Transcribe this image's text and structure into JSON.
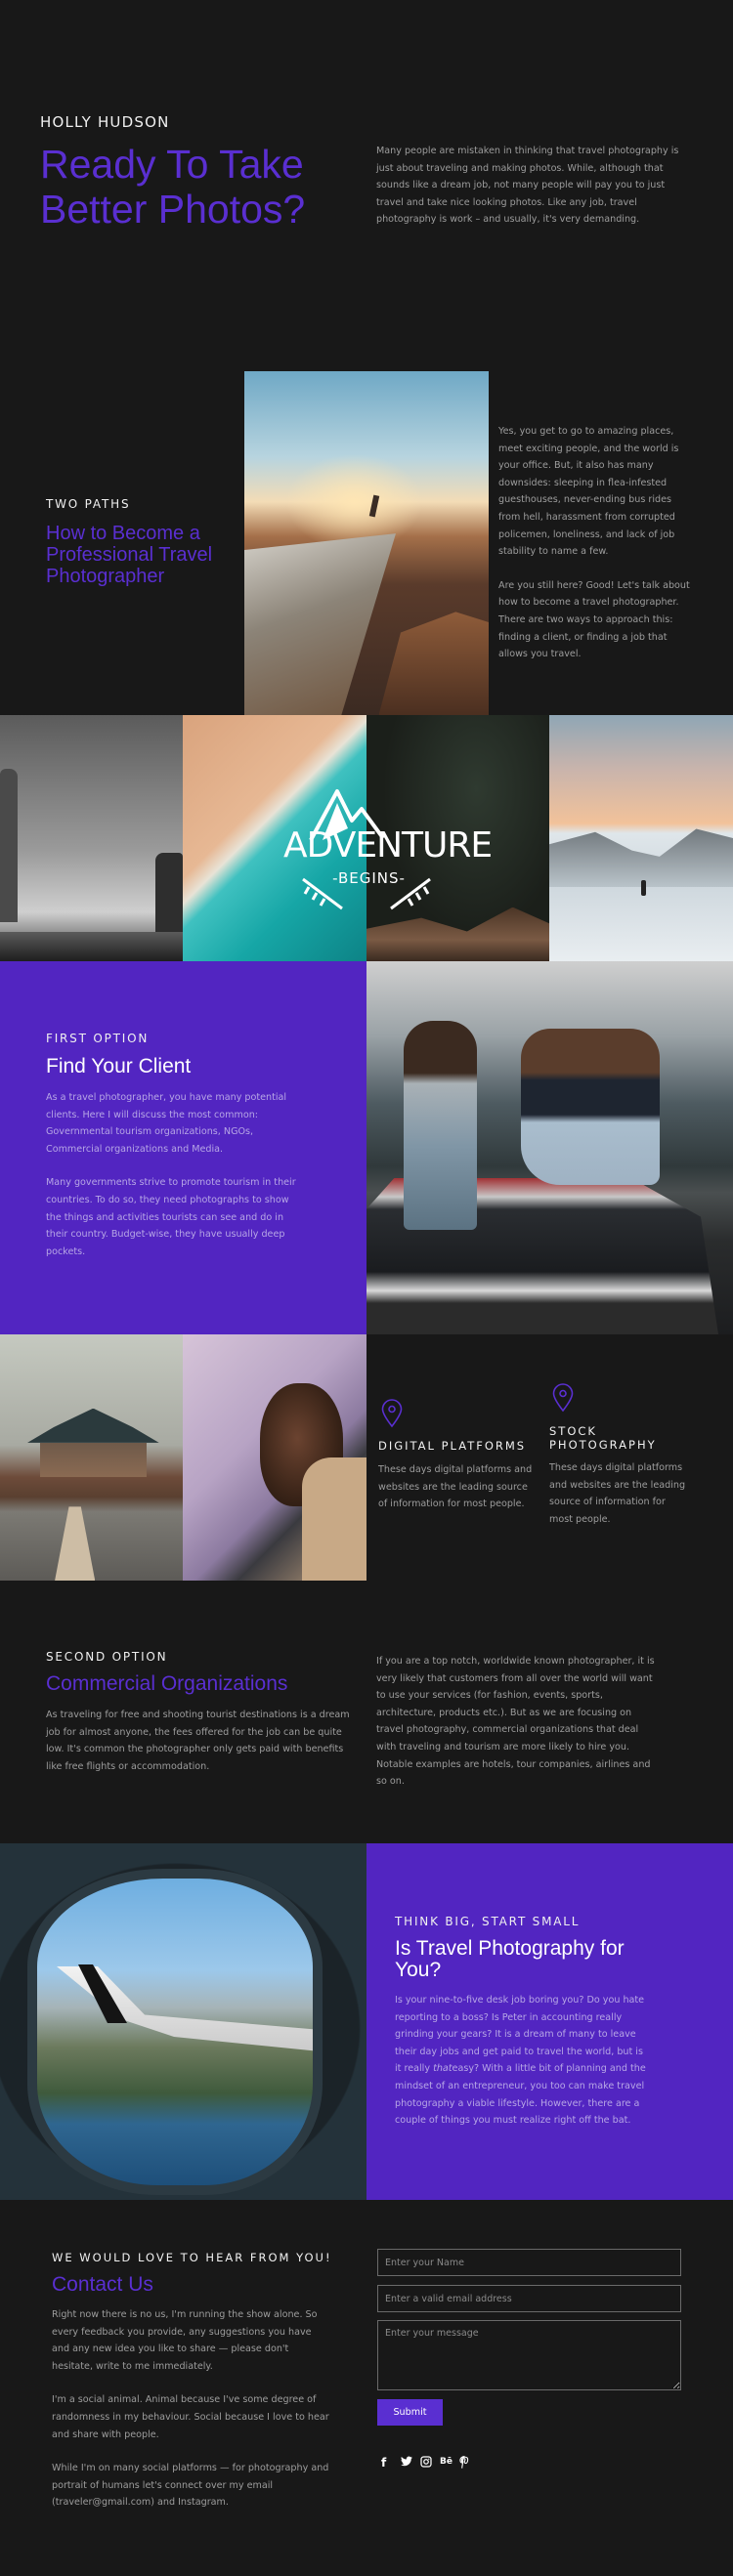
{
  "hero": {
    "author": "HOLLY HUDSON",
    "title_line1": "Ready To Take",
    "title_line2": "Better Photos?",
    "intro": "Many people are mistaken in thinking that travel photography is just about traveling and making photos. While, although that sounds like a dream job, not many people will pay you to just travel and take nice looking photos. Like any job, travel photography is work – and usually, it's very demanding."
  },
  "two_paths": {
    "eyebrow": "TWO PATHS",
    "title": "How to Become a Professional Travel Photographer",
    "paragraphs": [
      "Yes, you get to go to amazing places, meet exciting people, and the world is your office. But, it also has many downsides: sleeping in flea-infested guesthouses, never-ending bus rides from hell, harassment from corrupted policemen, loneliness, and lack of job stability to name a few.",
      "Are you still here? Good! Let's talk about how to become a travel photographer. There are two ways to approach this: finding a client, or finding a job that allows you travel."
    ]
  },
  "adventure": {
    "logo_word": "ADVENTURE",
    "logo_sub": "-BEGINS-"
  },
  "first_option": {
    "eyebrow": "FIRST OPTION",
    "title": "Find Your Client",
    "paragraphs": [
      "As a travel photographer, you have many potential clients. Here I will discuss the most common: Governmental tourism organizations, NGOs, Commercial organizations and Media.",
      "Many governments strive to promote tourism in their countries. To do so, they need photographs to show the things and activities tourists can see and do in their country. Budget-wise, they have usually deep pockets."
    ]
  },
  "features": [
    {
      "icon": "map-pin-icon",
      "title": "DIGITAL PLATFORMS",
      "text": "These days digital platforms and websites are the leading source of information for most people."
    },
    {
      "icon": "map-pin-icon",
      "title": "STOCK PHOTOGRAPHY",
      "text": "These days digital platforms and websites are the leading source of information for most people."
    }
  ],
  "second_option": {
    "eyebrow": "SECOND OPTION",
    "title": "Commercial Organizations",
    "left_text": "As traveling for free and shooting tourist destinations is a dream job for almost anyone, the fees offered for the job can be quite low. It's common the photographer only gets paid with benefits like free flights or accommodation.",
    "right_text": "If you are a top notch, worldwide known photographer, it is very likely that customers from all over the world will want to use your services (for fashion, events, sports, architecture, products etc.). But as we are focusing on travel photography, commercial organizations that deal with traveling and tourism are more likely to hire you. Notable examples are hotels, tour companies, airlines and so on."
  },
  "think_big": {
    "eyebrow": "THINK BIG, START SMALL",
    "title": "Is Travel Photography for You?",
    "text_before": "Is your nine-to-five desk job boring you? Do you hate reporting to a boss? Is Peter in accounting really grinding your gears? It is a dream of many to leave their day jobs and get paid to travel the world, but is it really ",
    "text_em": "that",
    "text_after": "easy? With a little bit of planning and the mindset of an entrepreneur, you too can make travel photography a viable lifestyle. However, there are a couple of things you must realize right off the bat."
  },
  "contact": {
    "eyebrow": "WE WOULD LOVE TO HEAR FROM YOU!",
    "title": "Contact Us",
    "paragraphs": [
      "Right now there is no us, I'm running the show alone. So every feedback you provide, any suggestions you have and any new idea you like to share — please don't hesitate, write to me immediately.",
      "I'm a social animal. Animal because I've some degree of randomness in my behaviour. Social because I love to hear and share with people.",
      "While I'm on many social platforms — for photography and portrait of humans let's connect over my email (traveler@gmail.com) and Instagram."
    ],
    "form": {
      "name_placeholder": "Enter your Name",
      "name_value": "",
      "email_placeholder": "Enter a valid email address",
      "email_value": "",
      "message_placeholder": "Enter your message",
      "message_value": "",
      "submit_label": "Submit"
    },
    "social": [
      {
        "name": "facebook-icon",
        "glyph": "f"
      },
      {
        "name": "twitter-icon",
        "glyph": "🐦"
      },
      {
        "name": "instagram-icon",
        "glyph": "◎"
      },
      {
        "name": "behance-icon",
        "glyph": "Bē"
      },
      {
        "name": "pinterest-icon",
        "glyph": "℘"
      }
    ]
  },
  "colors": {
    "background": "#181818",
    "accent_purple": "#5225c1",
    "heading_purple": "#5a2fd1"
  }
}
